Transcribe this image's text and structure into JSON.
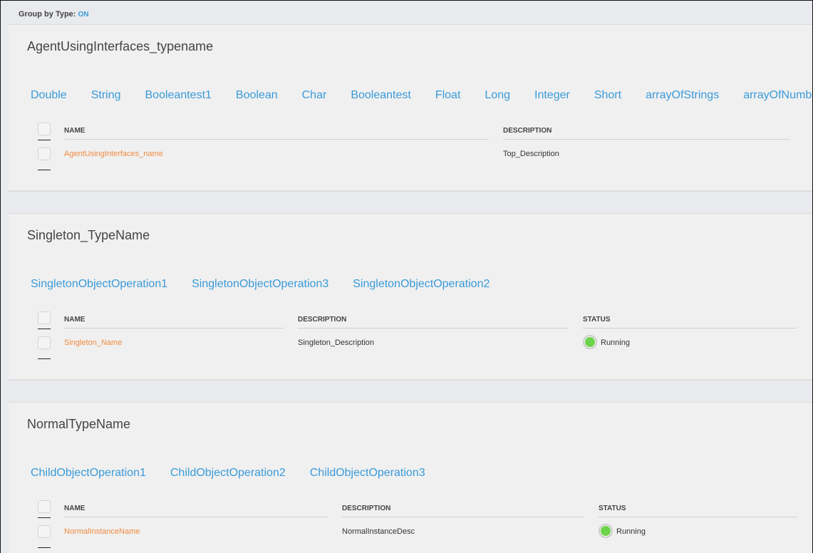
{
  "group_by": {
    "label": "Group by Type:",
    "value": "ON"
  },
  "headers": {
    "name": "NAME",
    "description": "DESCRIPTION",
    "status": "STATUS"
  },
  "cards": [
    {
      "title": "AgentUsingInterfaces_typename",
      "operations": [
        "Double",
        "String",
        "Booleantest1",
        "Boolean",
        "Char",
        "Booleantest",
        "Float",
        "Long",
        "Integer",
        "Short",
        "arrayOfStrings",
        "arrayOfNumbers"
      ],
      "row": {
        "name": "AgentUsingInterfaces_name",
        "description": "Top_Description"
      }
    },
    {
      "title": "Singleton_TypeName",
      "operations": [
        "SingletonObjectOperation1",
        "SingletonObjectOperation3",
        "SingletonObjectOperation2"
      ],
      "row": {
        "name": "Singleton_Name",
        "description": "Singleton_Description",
        "status": "Running"
      }
    },
    {
      "title": "NormalTypeName",
      "operations": [
        "ChildObjectOperation1",
        "ChildObjectOperation2",
        "ChildObjectOperation3"
      ],
      "row": {
        "name": "NormalInstanceName",
        "description": "NormalInstanceDesc",
        "status": "Running"
      }
    }
  ],
  "colors": {
    "link": "#3a9ad9",
    "name": "#f08a40",
    "running": "#6cd34a"
  }
}
